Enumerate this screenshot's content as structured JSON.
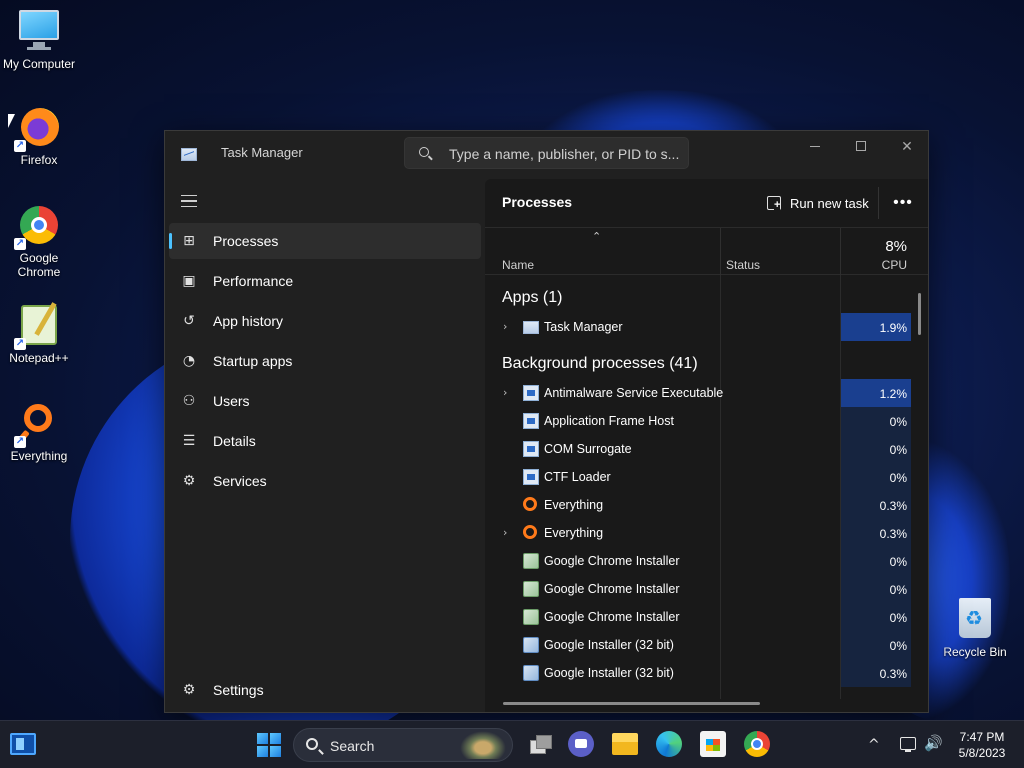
{
  "desktop": {
    "icons": [
      {
        "label": "My Computer",
        "icon": "monitor-icon"
      },
      {
        "label": "Firefox",
        "icon": "firefox-icon"
      },
      {
        "label": "Google Chrome",
        "icon": "chrome-icon"
      },
      {
        "label": "Notepad++",
        "icon": "notepad-plus-plus-icon"
      },
      {
        "label": "Everything",
        "icon": "everything-search-icon"
      },
      {
        "label": "Recycle Bin",
        "icon": "recycle-bin-icon"
      }
    ]
  },
  "window": {
    "title": "Task Manager",
    "search_placeholder": "Type a name, publisher, or PID to s...",
    "controls": {
      "minimize": "minimize-icon",
      "maximize": "maximize-icon",
      "close": "✕"
    }
  },
  "sidebar": {
    "items": [
      {
        "label": "Processes",
        "icon": "processes-icon",
        "active": true
      },
      {
        "label": "Performance",
        "icon": "performance-icon"
      },
      {
        "label": "App history",
        "icon": "history-icon"
      },
      {
        "label": "Startup apps",
        "icon": "startup-icon"
      },
      {
        "label": "Users",
        "icon": "users-icon"
      },
      {
        "label": "Details",
        "icon": "details-icon"
      },
      {
        "label": "Services",
        "icon": "services-icon"
      }
    ],
    "settings_label": "Settings"
  },
  "main": {
    "title": "Processes",
    "run_new_task": "Run new task",
    "more_label": "•••",
    "columns": {
      "name": "Name",
      "status": "Status",
      "cpu_total": "8%",
      "cpu": "CPU"
    },
    "apps_group": "Apps (1)",
    "apps": [
      {
        "name": "Task Manager",
        "cpu": "1.9%",
        "expandable": true,
        "icon": "task-manager-icon",
        "heat": 0.9
      }
    ],
    "background_group": "Background processes (41)",
    "background": [
      {
        "name": "Antimalware Service Executable",
        "cpu": "1.2%",
        "expandable": true,
        "icon": "window-app-icon",
        "heat": 0.8
      },
      {
        "name": "Application Frame Host",
        "cpu": "0%",
        "expandable": false,
        "icon": "window-app-icon",
        "heat": 0.15
      },
      {
        "name": "COM Surrogate",
        "cpu": "0%",
        "expandable": false,
        "icon": "window-app-icon",
        "heat": 0.15
      },
      {
        "name": "CTF Loader",
        "cpu": "0%",
        "expandable": false,
        "icon": "window-app-icon",
        "heat": 0.15
      },
      {
        "name": "Everything",
        "cpu": "0.3%",
        "expandable": false,
        "icon": "everything-search-icon",
        "heat": 0.25
      },
      {
        "name": "Everything",
        "cpu": "0.3%",
        "expandable": true,
        "icon": "everything-search-icon",
        "heat": 0.25
      },
      {
        "name": "Google Chrome Installer",
        "cpu": "0%",
        "expandable": false,
        "icon": "installer-icon",
        "heat": 0.15
      },
      {
        "name": "Google Chrome Installer",
        "cpu": "0%",
        "expandable": false,
        "icon": "installer-icon",
        "heat": 0.15
      },
      {
        "name": "Google Chrome Installer",
        "cpu": "0%",
        "expandable": false,
        "icon": "installer-icon",
        "heat": 0.15
      },
      {
        "name": "Google Installer (32 bit)",
        "cpu": "0%",
        "expandable": false,
        "icon": "google-installer-icon",
        "heat": 0.15
      },
      {
        "name": "Google Installer (32 bit)",
        "cpu": "0.3%",
        "expandable": false,
        "icon": "google-installer-icon",
        "heat": 0.25
      }
    ]
  },
  "taskbar": {
    "search_label": "Search",
    "apps": [
      "widgets-icon",
      "start-icon",
      "task-view-icon",
      "chat-icon",
      "file-explorer-icon",
      "edge-icon",
      "store-icon",
      "chrome-icon"
    ],
    "tray": {
      "chevron": "^",
      "volume": "🔊"
    },
    "time": "7:47 PM",
    "date": "5/8/2023"
  },
  "colors": {
    "accent": "#4cc2ff",
    "cpu_heat_high": "#1a3f8f",
    "cpu_heat_low": "#16243f"
  }
}
